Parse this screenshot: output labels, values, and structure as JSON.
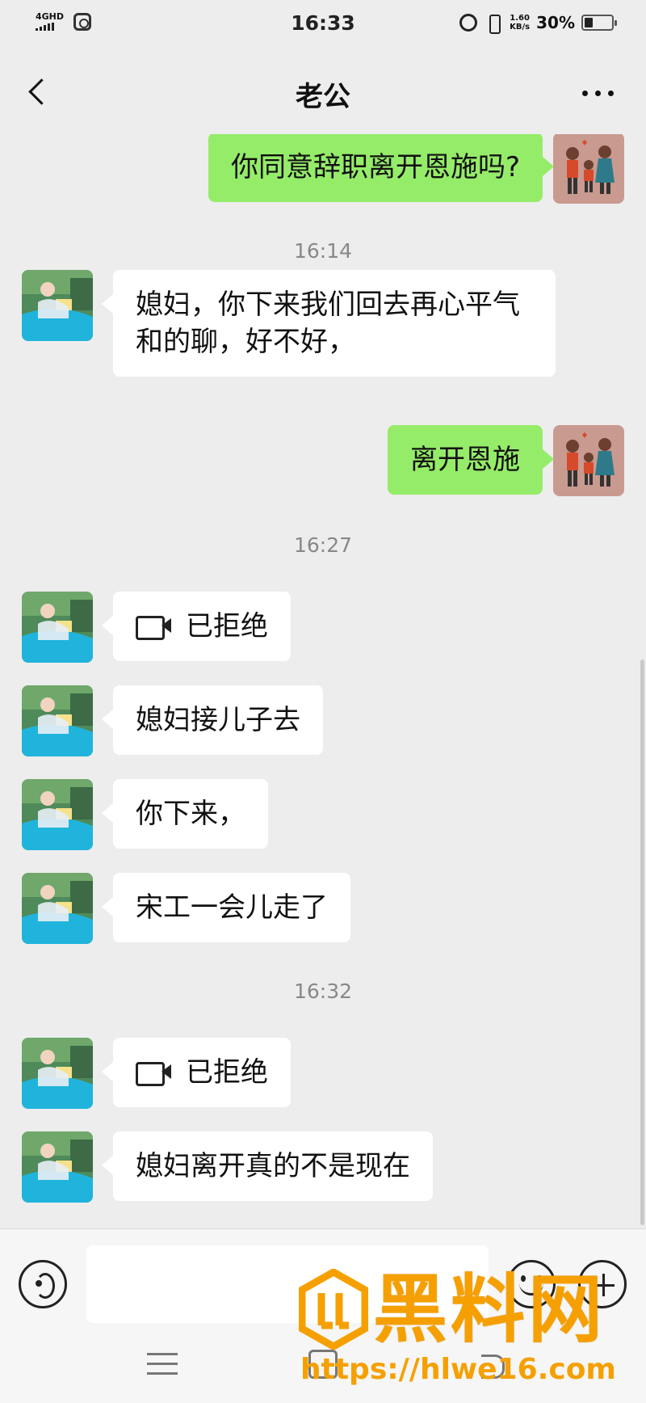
{
  "status_bar": {
    "network": "4GHD",
    "time": "16:33",
    "net_speed_value": "1.60",
    "net_speed_unit": "KB/s",
    "battery_percent": "30%",
    "battery_level": 0.3
  },
  "header": {
    "title": "老公"
  },
  "messages": [
    {
      "kind": "text",
      "side": "out",
      "text": "你同意辞职离开恩施吗?"
    },
    {
      "kind": "time",
      "text": "16:14"
    },
    {
      "kind": "text",
      "side": "in",
      "text": "媳妇，你下来我们回去再心平气和的聊，好不好，"
    },
    {
      "kind": "text",
      "side": "out",
      "text": "离开恩施"
    },
    {
      "kind": "time",
      "text": "16:27"
    },
    {
      "kind": "call",
      "side": "in",
      "text": "已拒绝"
    },
    {
      "kind": "text",
      "side": "in",
      "text": "媳妇接儿子去"
    },
    {
      "kind": "text",
      "side": "in",
      "text": "你下来，"
    },
    {
      "kind": "text",
      "side": "in",
      "text": "宋工一会儿走了"
    },
    {
      "kind": "time",
      "text": "16:32"
    },
    {
      "kind": "call",
      "side": "in",
      "text": "已拒绝"
    },
    {
      "kind": "text",
      "side": "in",
      "text": "媳妇离开真的不是现在"
    }
  ],
  "input": {
    "value": "",
    "placeholder": ""
  },
  "icons": {
    "back": "back-chevron-icon",
    "more": "more-dots-icon",
    "voice": "voice-icon",
    "emoji": "emoji-icon",
    "plus": "plus-icon",
    "video_call": "video-camera-icon"
  },
  "colors": {
    "background": "#ededed",
    "outgoing_bubble": "#95ec69",
    "incoming_bubble": "#ffffff",
    "watermark": "#f5a000"
  },
  "watermark": {
    "brand": "黑料网",
    "url": "https://hlwe16.com"
  }
}
